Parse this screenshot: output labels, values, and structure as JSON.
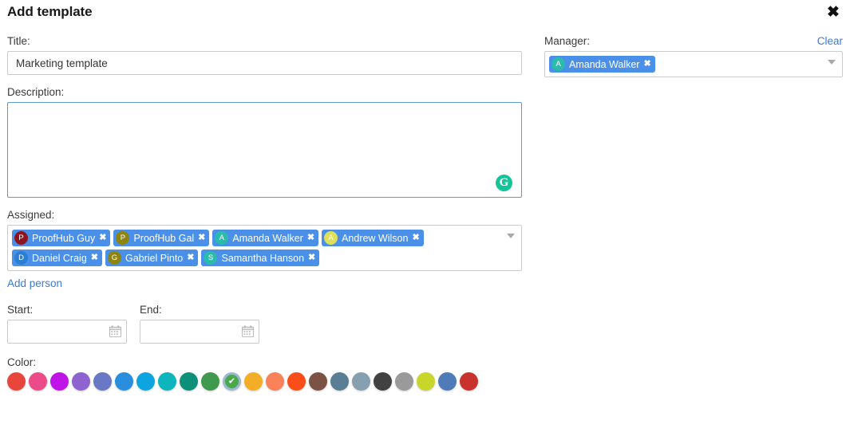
{
  "dialog": {
    "title": "Add template",
    "close_icon": "close-icon"
  },
  "form": {
    "title_label": "Title:",
    "title_value": "Marketing template",
    "title_placeholder": "",
    "description_label": "Description:",
    "description_value": "",
    "description_placeholder": "",
    "grammarly_icon": "G",
    "assigned_label": "Assigned:",
    "add_person_label": "Add person",
    "start_label": "Start:",
    "start_value": "",
    "end_label": "End:",
    "end_value": "",
    "color_label": "Color:"
  },
  "assigned": [
    {
      "initial": "P",
      "name": "ProofHub Guy",
      "avatar_color": "#8e1420"
    },
    {
      "initial": "P",
      "name": "ProofHub Gal",
      "avatar_color": "#8e8410"
    },
    {
      "initial": "A",
      "name": "Amanda Walker",
      "avatar_color": "#2bbbad"
    },
    {
      "initial": "A",
      "name": "Andrew Wilson",
      "avatar_color": "#e0df5a"
    },
    {
      "initial": "D",
      "name": "Daniel Craig",
      "avatar_color": "#2a7fd4"
    },
    {
      "initial": "G",
      "name": "Gabriel Pinto",
      "avatar_color": "#8e8410"
    },
    {
      "initial": "S",
      "name": "Samantha Hanson",
      "avatar_color": "#2bbbad"
    }
  ],
  "manager": {
    "label": "Manager:",
    "clear_label": "Clear",
    "selected": {
      "initial": "A",
      "name": "Amanda Walker",
      "avatar_color": "#2bbbad"
    }
  },
  "colors": {
    "selected_index": 10,
    "swatches": [
      "#e8453c",
      "#ec4a88",
      "#c013e8",
      "#8e63cf",
      "#6878c4",
      "#2a8ede",
      "#0da5e0",
      "#0fb5bd",
      "#0e8f7a",
      "#3f9a4e",
      "#4aa84a",
      "#f4ad26",
      "#f9825b",
      "#fa4e1a",
      "#7b5344",
      "#5a7e93",
      "#86a0b0",
      "#414141",
      "#9a9a9a",
      "#c8d62b",
      "#4f7cb8",
      "#c8332e"
    ]
  },
  "theme": {
    "chip_background": "#4a90e8",
    "link_color": "#3a7bd5",
    "focus_border": "#5b9bd5",
    "grammarly_green": "#15c39a"
  }
}
